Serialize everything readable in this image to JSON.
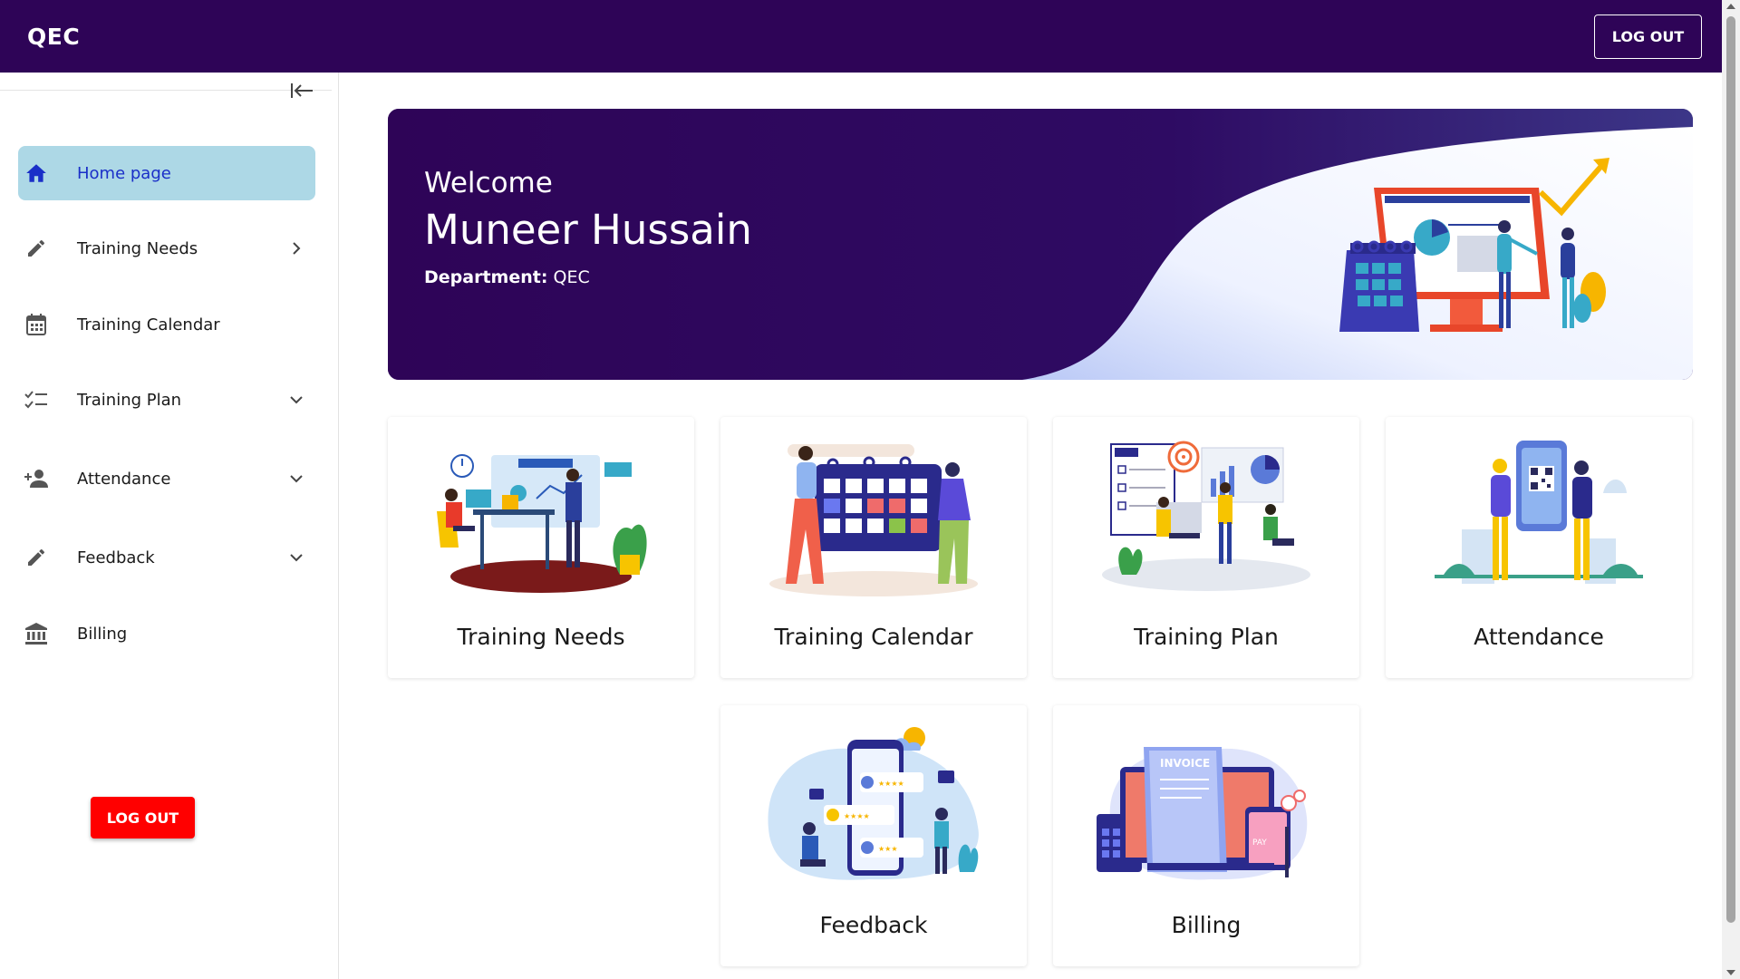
{
  "app": {
    "title": "QEC",
    "logout_label": "LOG OUT"
  },
  "sidebar": {
    "items": [
      {
        "label": "Home page",
        "icon": "home-icon",
        "active": true,
        "chevron": "none"
      },
      {
        "label": "Training Needs",
        "icon": "pencil-icon",
        "chevron": "right"
      },
      {
        "label": "Training Calendar",
        "icon": "calendar-icon",
        "chevron": "none"
      },
      {
        "label": "Training Plan",
        "icon": "checklist-icon",
        "chevron": "down"
      },
      {
        "label": "Attendance",
        "icon": "person-add-icon",
        "chevron": "down"
      },
      {
        "label": "Feedback",
        "icon": "pencil-icon",
        "chevron": "down"
      },
      {
        "label": "Billing",
        "icon": "bank-icon",
        "chevron": "none"
      }
    ],
    "logout_label": "LOG OUT"
  },
  "banner": {
    "welcome": "Welcome",
    "name": "Muneer Hussain",
    "department_label": "Department:",
    "department_value": "QEC"
  },
  "cards": [
    {
      "title": "Training Needs",
      "illustration": "training-needs-illustration"
    },
    {
      "title": "Training Calendar",
      "illustration": "training-calendar-illustration"
    },
    {
      "title": "Training Plan",
      "illustration": "training-plan-illustration"
    },
    {
      "title": "Attendance",
      "illustration": "attendance-illustration"
    },
    {
      "title": "Feedback",
      "illustration": "feedback-illustration"
    },
    {
      "title": "Billing",
      "illustration": "billing-illustration"
    }
  ],
  "colors": {
    "primary": "#2e0457",
    "active_bg": "#add8e6",
    "active_text": "#1a2fc8",
    "logout_red": "#ff0000"
  }
}
